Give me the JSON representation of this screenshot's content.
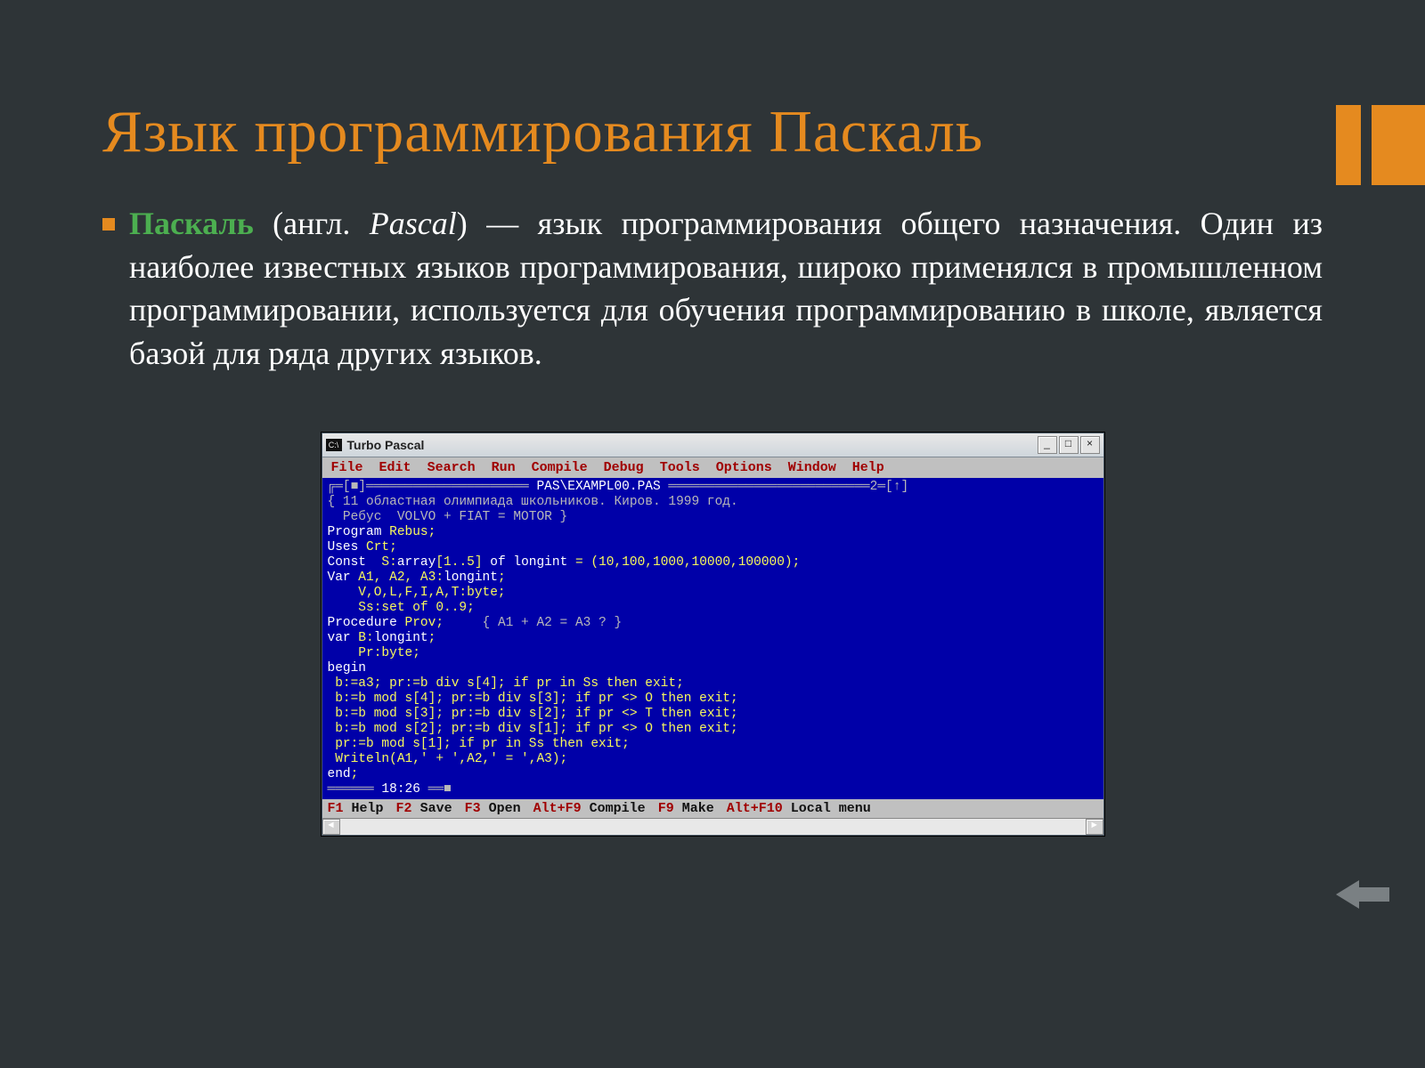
{
  "slide": {
    "title": "Язык программирования Паскаль",
    "body": {
      "bold": "Паскаль",
      "paren_open": " (англ. ",
      "italic": "Pascal",
      "paren_close": ")",
      "rest": " — язык программирования общего назначения. Один из наиболее известных языков программирования, широко применялся в промышленном программировании, используется для обучения программированию в школе, является базой для ряда других языков."
    }
  },
  "tp": {
    "sysicon": "C:\\",
    "title": "Turbo Pascal",
    "winbtns": {
      "min": "_",
      "max": "□",
      "close": "×"
    },
    "menu": [
      "File",
      "Edit",
      "Search",
      "Run",
      "Compile",
      "Debug",
      "Tools",
      "Options",
      "Window",
      "Help"
    ],
    "frame_top_left": "╔═[■]═",
    "frame_file": " PAS\\EXAMPL00.PAS ",
    "frame_top_right_marker": "2═[↑]",
    "code": [
      "{ 11 областная олимпиада школьников. Киров. 1999 год.",
      "  Ребус  VOLVO + FIAT = MOTOR }",
      "Program Rebus;",
      "Uses Crt;",
      "Const  S:array[1..5] of longint = (10,100,1000,10000,100000);",
      "Var A1, A2, A3:longint;",
      "    V,O,L,F,I,A,T:byte;",
      "    Ss:set of 0..9;",
      "Procedure Prov;     { A1 + A2 = A3 ? }",
      "var B:longint;",
      "    Pr:byte;",
      "begin",
      " b:=a3; pr:=b div s[4]; if pr in Ss then exit;",
      " b:=b mod s[4]; pr:=b div s[3]; if pr <> O then exit;",
      " b:=b mod s[3]; pr:=b div s[2]; if pr <> T then exit;",
      " b:=b mod s[2]; pr:=b div s[1]; if pr <> O then exit;",
      " pr:=b mod s[1]; if pr in Ss then exit;",
      " Writeln(A1,' + ',A2,' = ',A3);",
      "end;"
    ],
    "frame_bottom_left": "══════ ",
    "clock": "18:26",
    "frame_bottom_right": " ══■",
    "status": [
      {
        "key": "F1",
        "label": "Help"
      },
      {
        "key": "F2",
        "label": "Save"
      },
      {
        "key": "F3",
        "label": "Open"
      },
      {
        "key": "Alt+F9",
        "label": "Compile"
      },
      {
        "key": "F9",
        "label": "Make"
      },
      {
        "key": "Alt+F10",
        "label": "Local menu"
      }
    ],
    "hscroll": {
      "left": "◄",
      "right": "►"
    }
  }
}
